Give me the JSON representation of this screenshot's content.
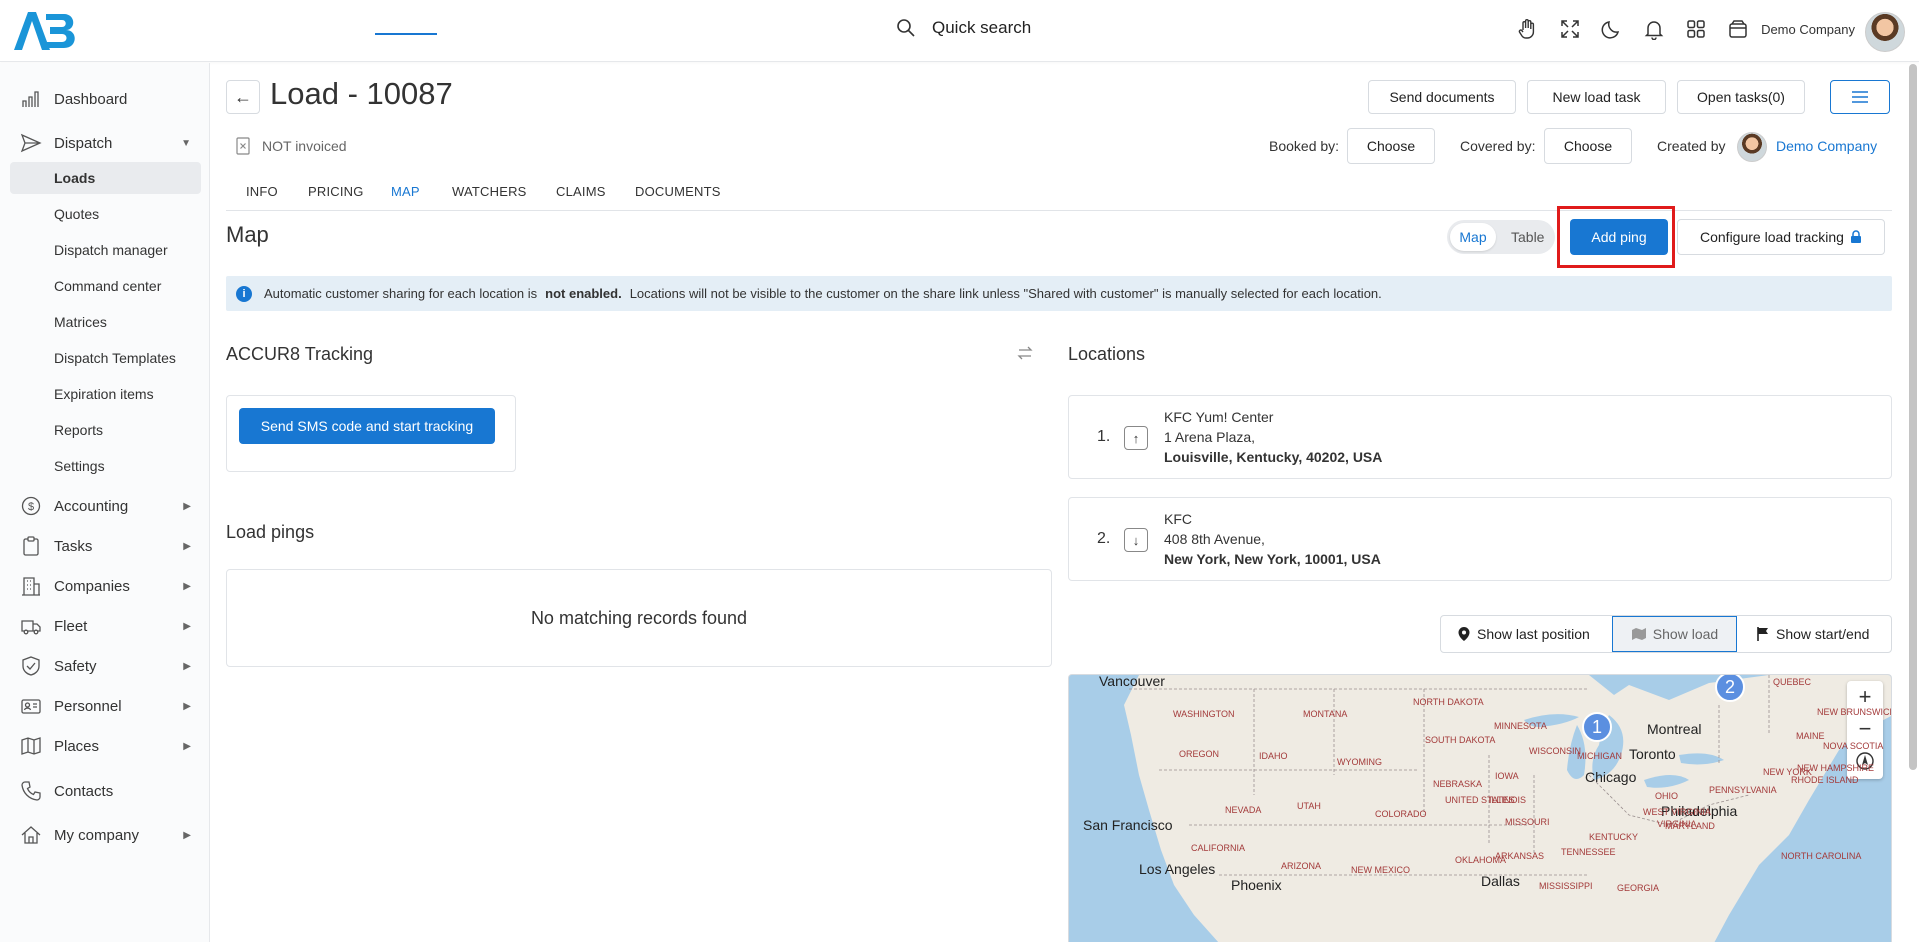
{
  "header": {
    "search_label": "Quick search",
    "company_name": "Demo Company"
  },
  "sidebar": {
    "items": [
      {
        "label": "Dashboard"
      },
      {
        "label": "Dispatch"
      },
      {
        "label": "Accounting"
      },
      {
        "label": "Tasks"
      },
      {
        "label": "Companies"
      },
      {
        "label": "Fleet"
      },
      {
        "label": "Safety"
      },
      {
        "label": "Personnel"
      },
      {
        "label": "Places"
      },
      {
        "label": "Contacts"
      },
      {
        "label": "My company"
      }
    ],
    "dispatch_sub": [
      {
        "label": "Loads"
      },
      {
        "label": "Quotes"
      },
      {
        "label": "Dispatch manager"
      },
      {
        "label": "Command center"
      },
      {
        "label": "Matrices"
      },
      {
        "label": "Dispatch Templates"
      },
      {
        "label": "Expiration items"
      },
      {
        "label": "Reports"
      },
      {
        "label": "Settings"
      }
    ]
  },
  "page": {
    "title": "Load - 10087",
    "invoice_status": "NOT invoiced",
    "buttons": {
      "send_documents": "Send documents",
      "new_load_task": "New load task",
      "open_tasks": "Open tasks(0)"
    },
    "booked_by_label": "Booked by:",
    "covered_by_label": "Covered by:",
    "choose_label": "Choose",
    "created_by_label": "Created by",
    "created_by_value": "Demo Company"
  },
  "tabs": [
    {
      "label": "INFO"
    },
    {
      "label": "PRICING"
    },
    {
      "label": "MAP"
    },
    {
      "label": "WATCHERS"
    },
    {
      "label": "CLAIMS"
    },
    {
      "label": "DOCUMENTS"
    }
  ],
  "map_section": {
    "title": "Map",
    "toggle_map": "Map",
    "toggle_table": "Table",
    "add_ping": "Add ping",
    "configure_tracking": "Configure load tracking"
  },
  "banner": {
    "prefix": "Automatic customer sharing for each location is",
    "bold": "not enabled.",
    "suffix": "Locations will not be visible to the customer on the share link unless \"Shared with customer\" is manually selected for each location."
  },
  "tracking": {
    "title": "ACCUR8 Tracking",
    "sms_button": "Send SMS code and start tracking"
  },
  "pings": {
    "title": "Load pings",
    "empty": "No matching records found"
  },
  "locations": {
    "title": "Locations",
    "items": [
      {
        "num": "1.",
        "name": "KFC Yum! Center",
        "street": "1 Arena Plaza,",
        "city": "Louisville, Kentucky, 40202, USA"
      },
      {
        "num": "2.",
        "name": "KFC",
        "street": "408 8th Avenue,",
        "city": "New York, New York, 10001, USA"
      }
    ]
  },
  "map_controls": {
    "last_position": "Show last position",
    "show_load": "Show load",
    "start_end": "Show start/end"
  },
  "map_labels": {
    "cities": [
      "Vancouver",
      "Montreal",
      "Toronto",
      "Chicago",
      "Philadelphia",
      "San Francisco",
      "Los Angeles",
      "Phoenix",
      "Dallas"
    ],
    "states": [
      "WASHINGTON",
      "MONTANA",
      "NORTH DAKOTA",
      "MINNESOTA",
      "QUEBEC",
      "NEW BRUNSWICK",
      "MAINE",
      "NOVA SCOTIA",
      "OREGON",
      "IDAHO",
      "WYOMING",
      "SOUTH DAKOTA",
      "WISCONSIN",
      "MICHIGAN",
      "NEW HAMPSHIRE",
      "RHODE ISLAND",
      "NEW YORK",
      "PENNSYLVANIA",
      "NEBRASKA",
      "IOWA",
      "OHIO",
      "NEVADA",
      "UTAH",
      "COLORADO",
      "UNITED STATES",
      "ILLINOIS",
      "WEST VIRGINIA",
      "VIRGINIA",
      "MARYLAND",
      "MISSOURI",
      "KENTUCKY",
      "CALIFORNIA",
      "ARIZONA",
      "NEW MEXICO",
      "OKLAHOMA",
      "ARKANSAS",
      "TENNESSEE",
      "NORTH CAROLINA",
      "MISSISSIPPI",
      "GEORGIA"
    ],
    "pins": [
      "1",
      "2"
    ]
  }
}
